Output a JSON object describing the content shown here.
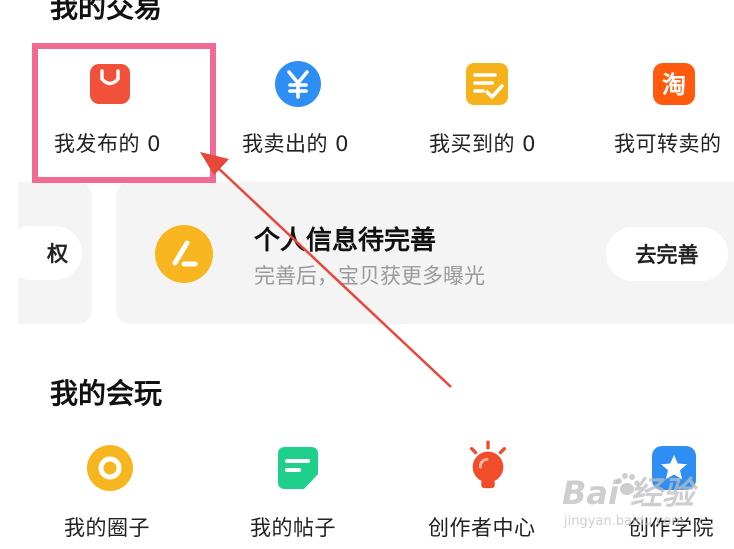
{
  "trades": {
    "title": "我的交易",
    "items": [
      {
        "label": "我发布的 0",
        "icon": "shopping-bag-icon",
        "color": "#f1503b"
      },
      {
        "label": "我卖出的 0",
        "icon": "yen-coin-icon",
        "color": "#2e8ef4"
      },
      {
        "label": "我买到的 0",
        "icon": "checklist-icon",
        "color": "#f6b21c"
      },
      {
        "label": "我可转卖的",
        "icon": "taobao-icon",
        "color": "#ff5a0d"
      }
    ]
  },
  "info_card": {
    "left_partial_label": "权",
    "title": "个人信息待完善",
    "subtitle": "完善后，宝贝获更多曝光",
    "button": "去完善",
    "icon_color": "#f7b51f"
  },
  "play": {
    "title": "我的会玩",
    "items": [
      {
        "label": "我的圈子",
        "icon": "circle-ring-icon",
        "color": "#f7b51f"
      },
      {
        "label": "我的帖子",
        "icon": "post-note-icon",
        "color": "#1fcf8c"
      },
      {
        "label": "创作者中心",
        "icon": "lightbulb-icon",
        "color": "#f24d2b"
      },
      {
        "label": "创作学院",
        "icon": "star-badge-icon",
        "color": "#2e8ef4"
      }
    ]
  },
  "annotation": {
    "highlight_color": "#f06a94",
    "arrow_color": "#e8473b"
  },
  "watermark": {
    "brand": "Bai 经验",
    "url": "jingyan.baidu.com"
  }
}
